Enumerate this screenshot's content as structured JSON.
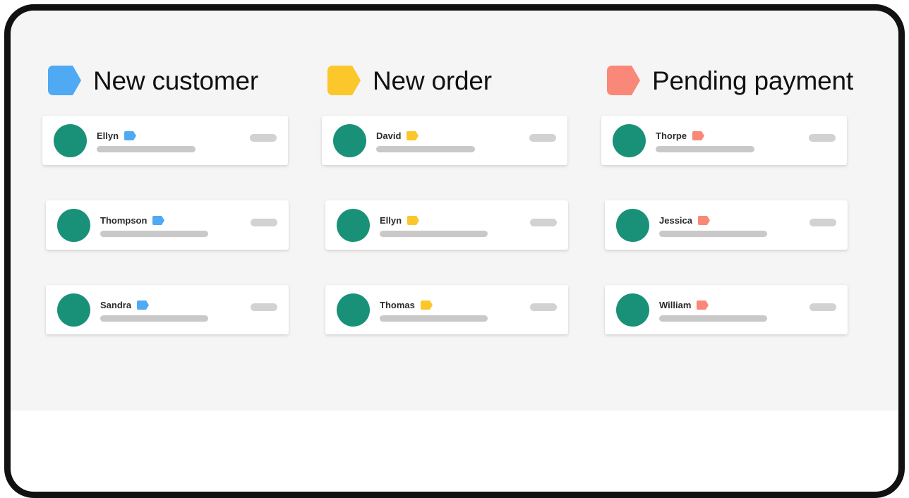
{
  "board": {
    "surface_color": "#f5f5f5",
    "frame_color": "#111111",
    "avatar_color": "#189178",
    "placeholder_color": "#c9c9c9",
    "pill_color": "#d2d2d2",
    "columns": [
      {
        "title": "New customer",
        "tag_icon": "tag-icon",
        "tag_color": "#4fa9f3",
        "cards": [
          {
            "name": "Ellyn",
            "tag_icon": "tag-icon",
            "avatar_icon": "avatar",
            "status_icon": "status-pill"
          },
          {
            "name": "Thompson",
            "tag_icon": "tag-icon",
            "avatar_icon": "avatar",
            "status_icon": "status-pill"
          },
          {
            "name": "Sandra",
            "tag_icon": "tag-icon",
            "avatar_icon": "avatar",
            "status_icon": "status-pill"
          }
        ]
      },
      {
        "title": "New order",
        "tag_icon": "tag-icon",
        "tag_color": "#fbc72a",
        "cards": [
          {
            "name": "David",
            "tag_icon": "tag-icon",
            "avatar_icon": "avatar",
            "status_icon": "status-pill"
          },
          {
            "name": "Ellyn",
            "tag_icon": "tag-icon",
            "avatar_icon": "avatar",
            "status_icon": "status-pill"
          },
          {
            "name": "Thomas",
            "tag_icon": "tag-icon",
            "avatar_icon": "avatar",
            "status_icon": "status-pill"
          }
        ]
      },
      {
        "title": "Pending payment",
        "tag_icon": "tag-icon",
        "tag_color": "#f98878",
        "cards": [
          {
            "name": "Thorpe",
            "tag_icon": "tag-icon",
            "avatar_icon": "avatar",
            "status_icon": "status-pill"
          },
          {
            "name": "Jessica",
            "tag_icon": "tag-icon",
            "avatar_icon": "avatar",
            "status_icon": "status-pill"
          },
          {
            "name": "William",
            "tag_icon": "tag-icon",
            "avatar_icon": "avatar",
            "status_icon": "status-pill"
          }
        ]
      }
    ]
  }
}
